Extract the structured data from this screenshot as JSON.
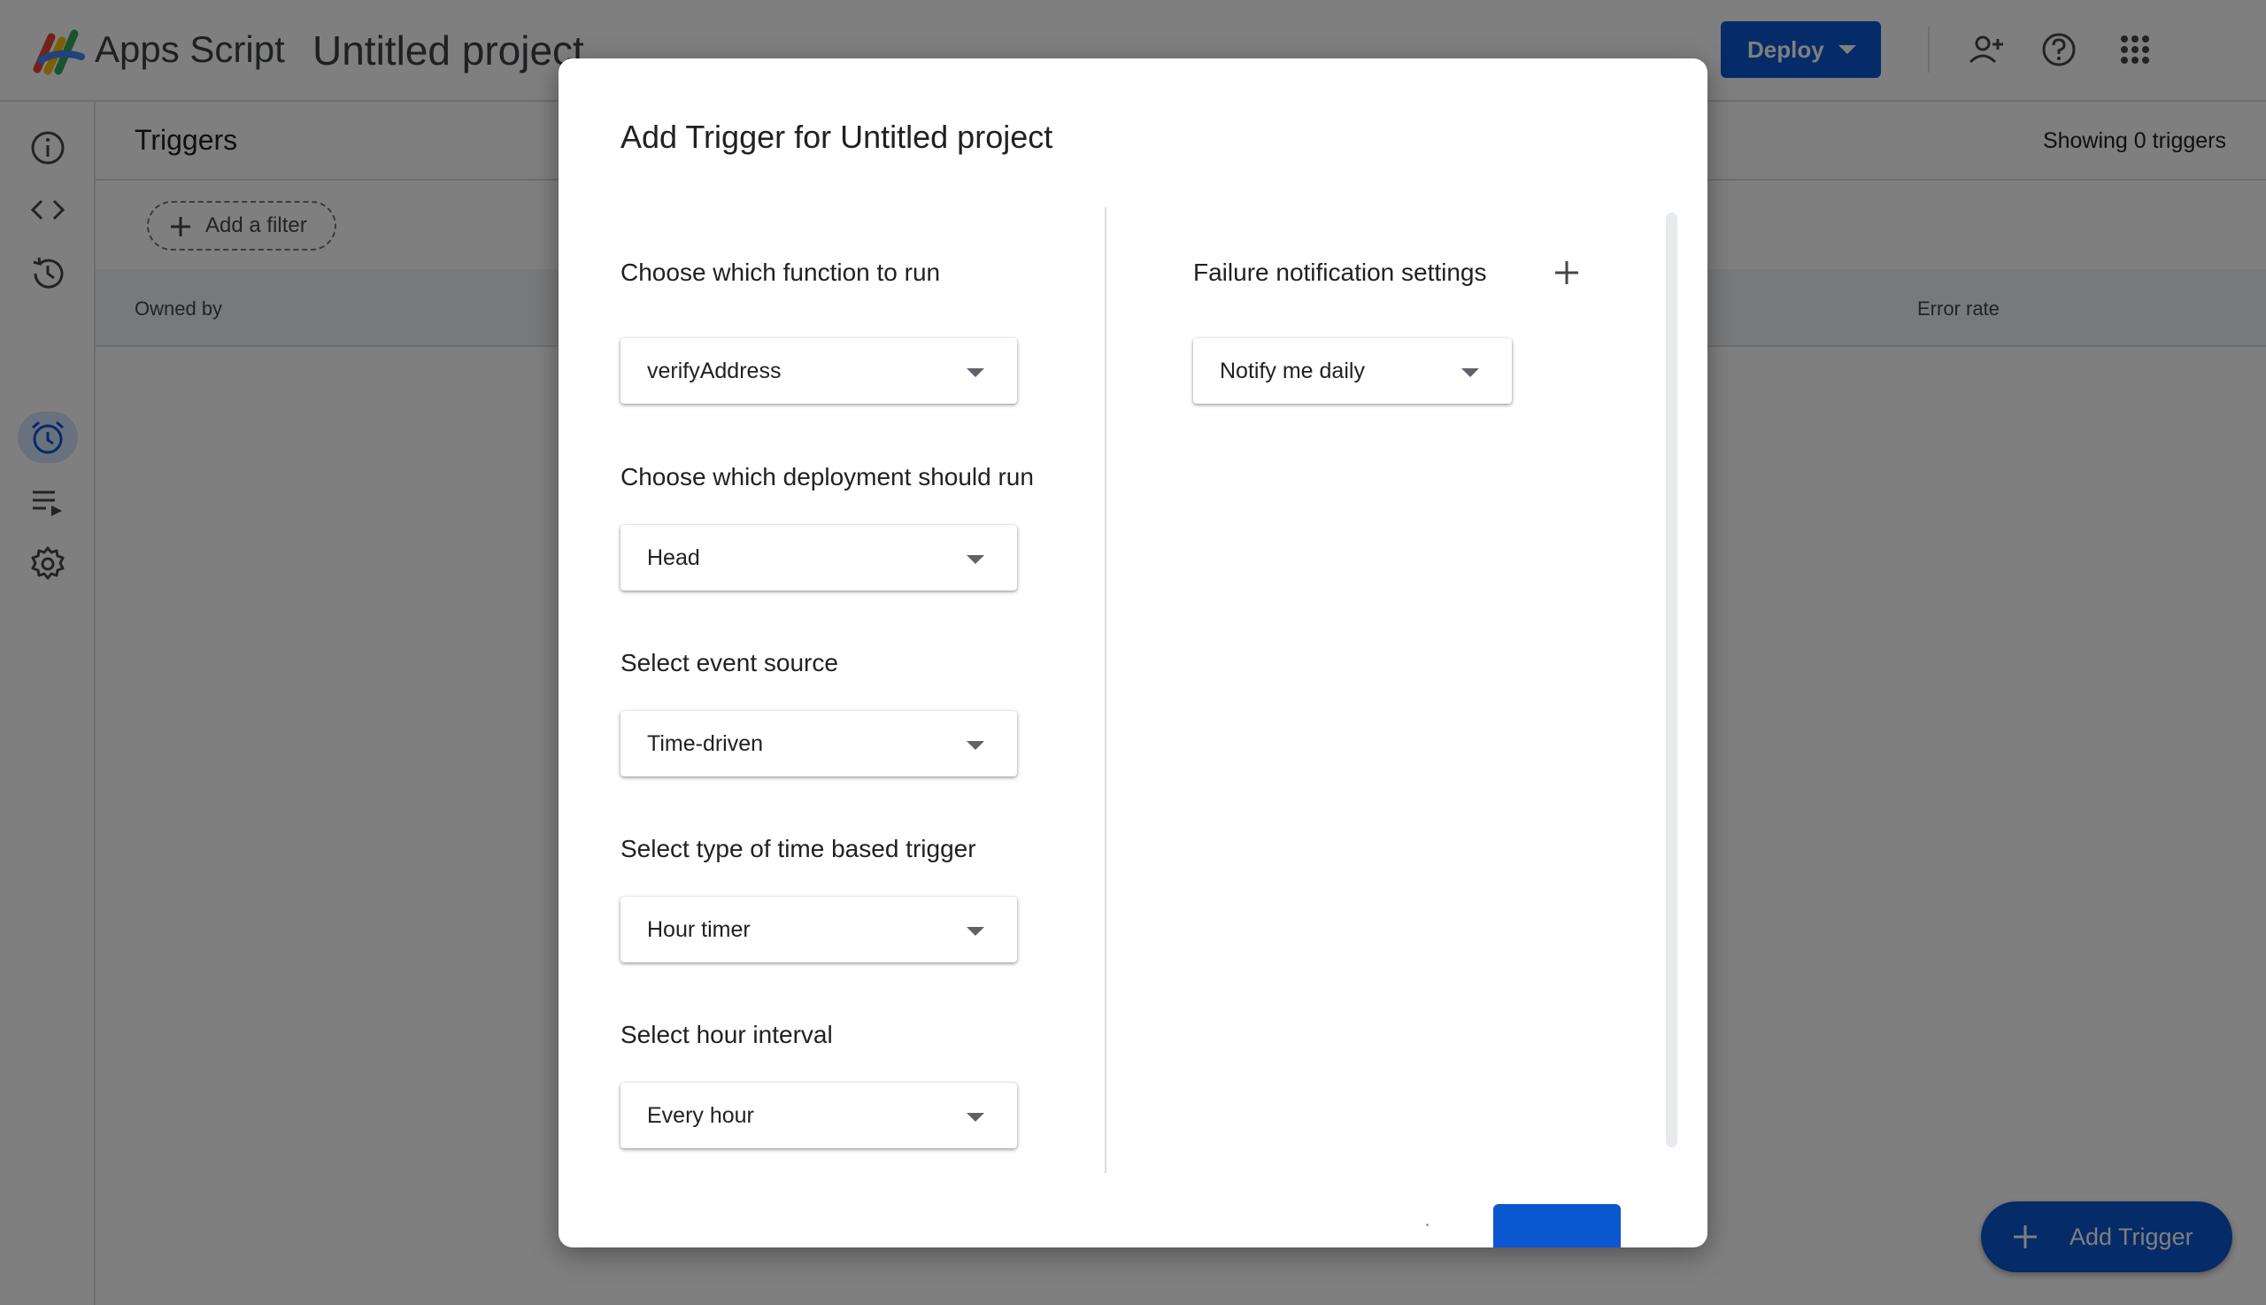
{
  "app": {
    "name": "Apps Script",
    "project": "Untitled project",
    "deploy_label": "Deploy"
  },
  "page": {
    "title": "Triggers",
    "showing_count": "Showing 0 triggers",
    "filter_label": "Add a filter",
    "columns": {
      "owned_by": "Owned by",
      "error_rate": "Error rate"
    },
    "fab_label": "Add Trigger"
  },
  "dialog": {
    "title": "Add Trigger for Untitled project",
    "fields": [
      {
        "label": "Choose which function to run",
        "value": "verifyAddress"
      },
      {
        "label": "Choose which deployment should run",
        "value": "Head"
      },
      {
        "label": "Select event source",
        "value": "Time-driven"
      },
      {
        "label": "Select type of time based trigger",
        "value": "Hour timer"
      },
      {
        "label": "Select hour interval",
        "value": "Every hour"
      }
    ],
    "failure": {
      "label": "Failure notification settings",
      "value": "Notify me daily"
    }
  },
  "colors": {
    "primary": "#0b57d0",
    "active_nav": "#d3e3fd",
    "scrim": "rgba(0,0,0,0.5)"
  },
  "icons": {
    "rail": [
      "info-icon",
      "code-icon",
      "history-icon",
      "alarm-clock-icon",
      "run-list-icon",
      "gear-icon"
    ],
    "top": [
      "add-person-icon",
      "help-icon",
      "apps-grid-icon"
    ]
  }
}
